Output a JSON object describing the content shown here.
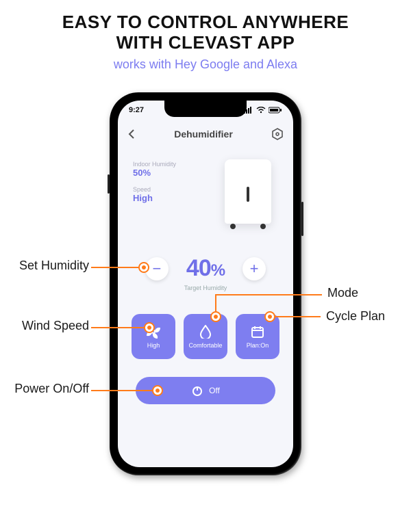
{
  "headline": {
    "line1": "EASY TO CONTROL ANYWHERE",
    "line2": "WITH CLEVAST APP",
    "sub": "works with Hey Google and Alexa"
  },
  "status": {
    "time": "9:27"
  },
  "header": {
    "title": "Dehumidifier"
  },
  "readouts": {
    "humidity_label": "Indoor Humidity",
    "humidity_value": "50%",
    "speed_label": "Speed",
    "speed_value": "High"
  },
  "target": {
    "value": "40",
    "unit": "%",
    "label": "Target Humidity",
    "minus": "−",
    "plus": "+"
  },
  "tiles": {
    "wind_label": "High",
    "mode_label": "Comfortable",
    "plan_label": "Plan:On"
  },
  "power": {
    "label": "Off"
  },
  "callouts": {
    "set_humidity": "Set Humidity",
    "wind_speed": "Wind Speed",
    "power": "Power On/Off",
    "mode": "Mode",
    "cycle_plan": "Cycle Plan"
  }
}
